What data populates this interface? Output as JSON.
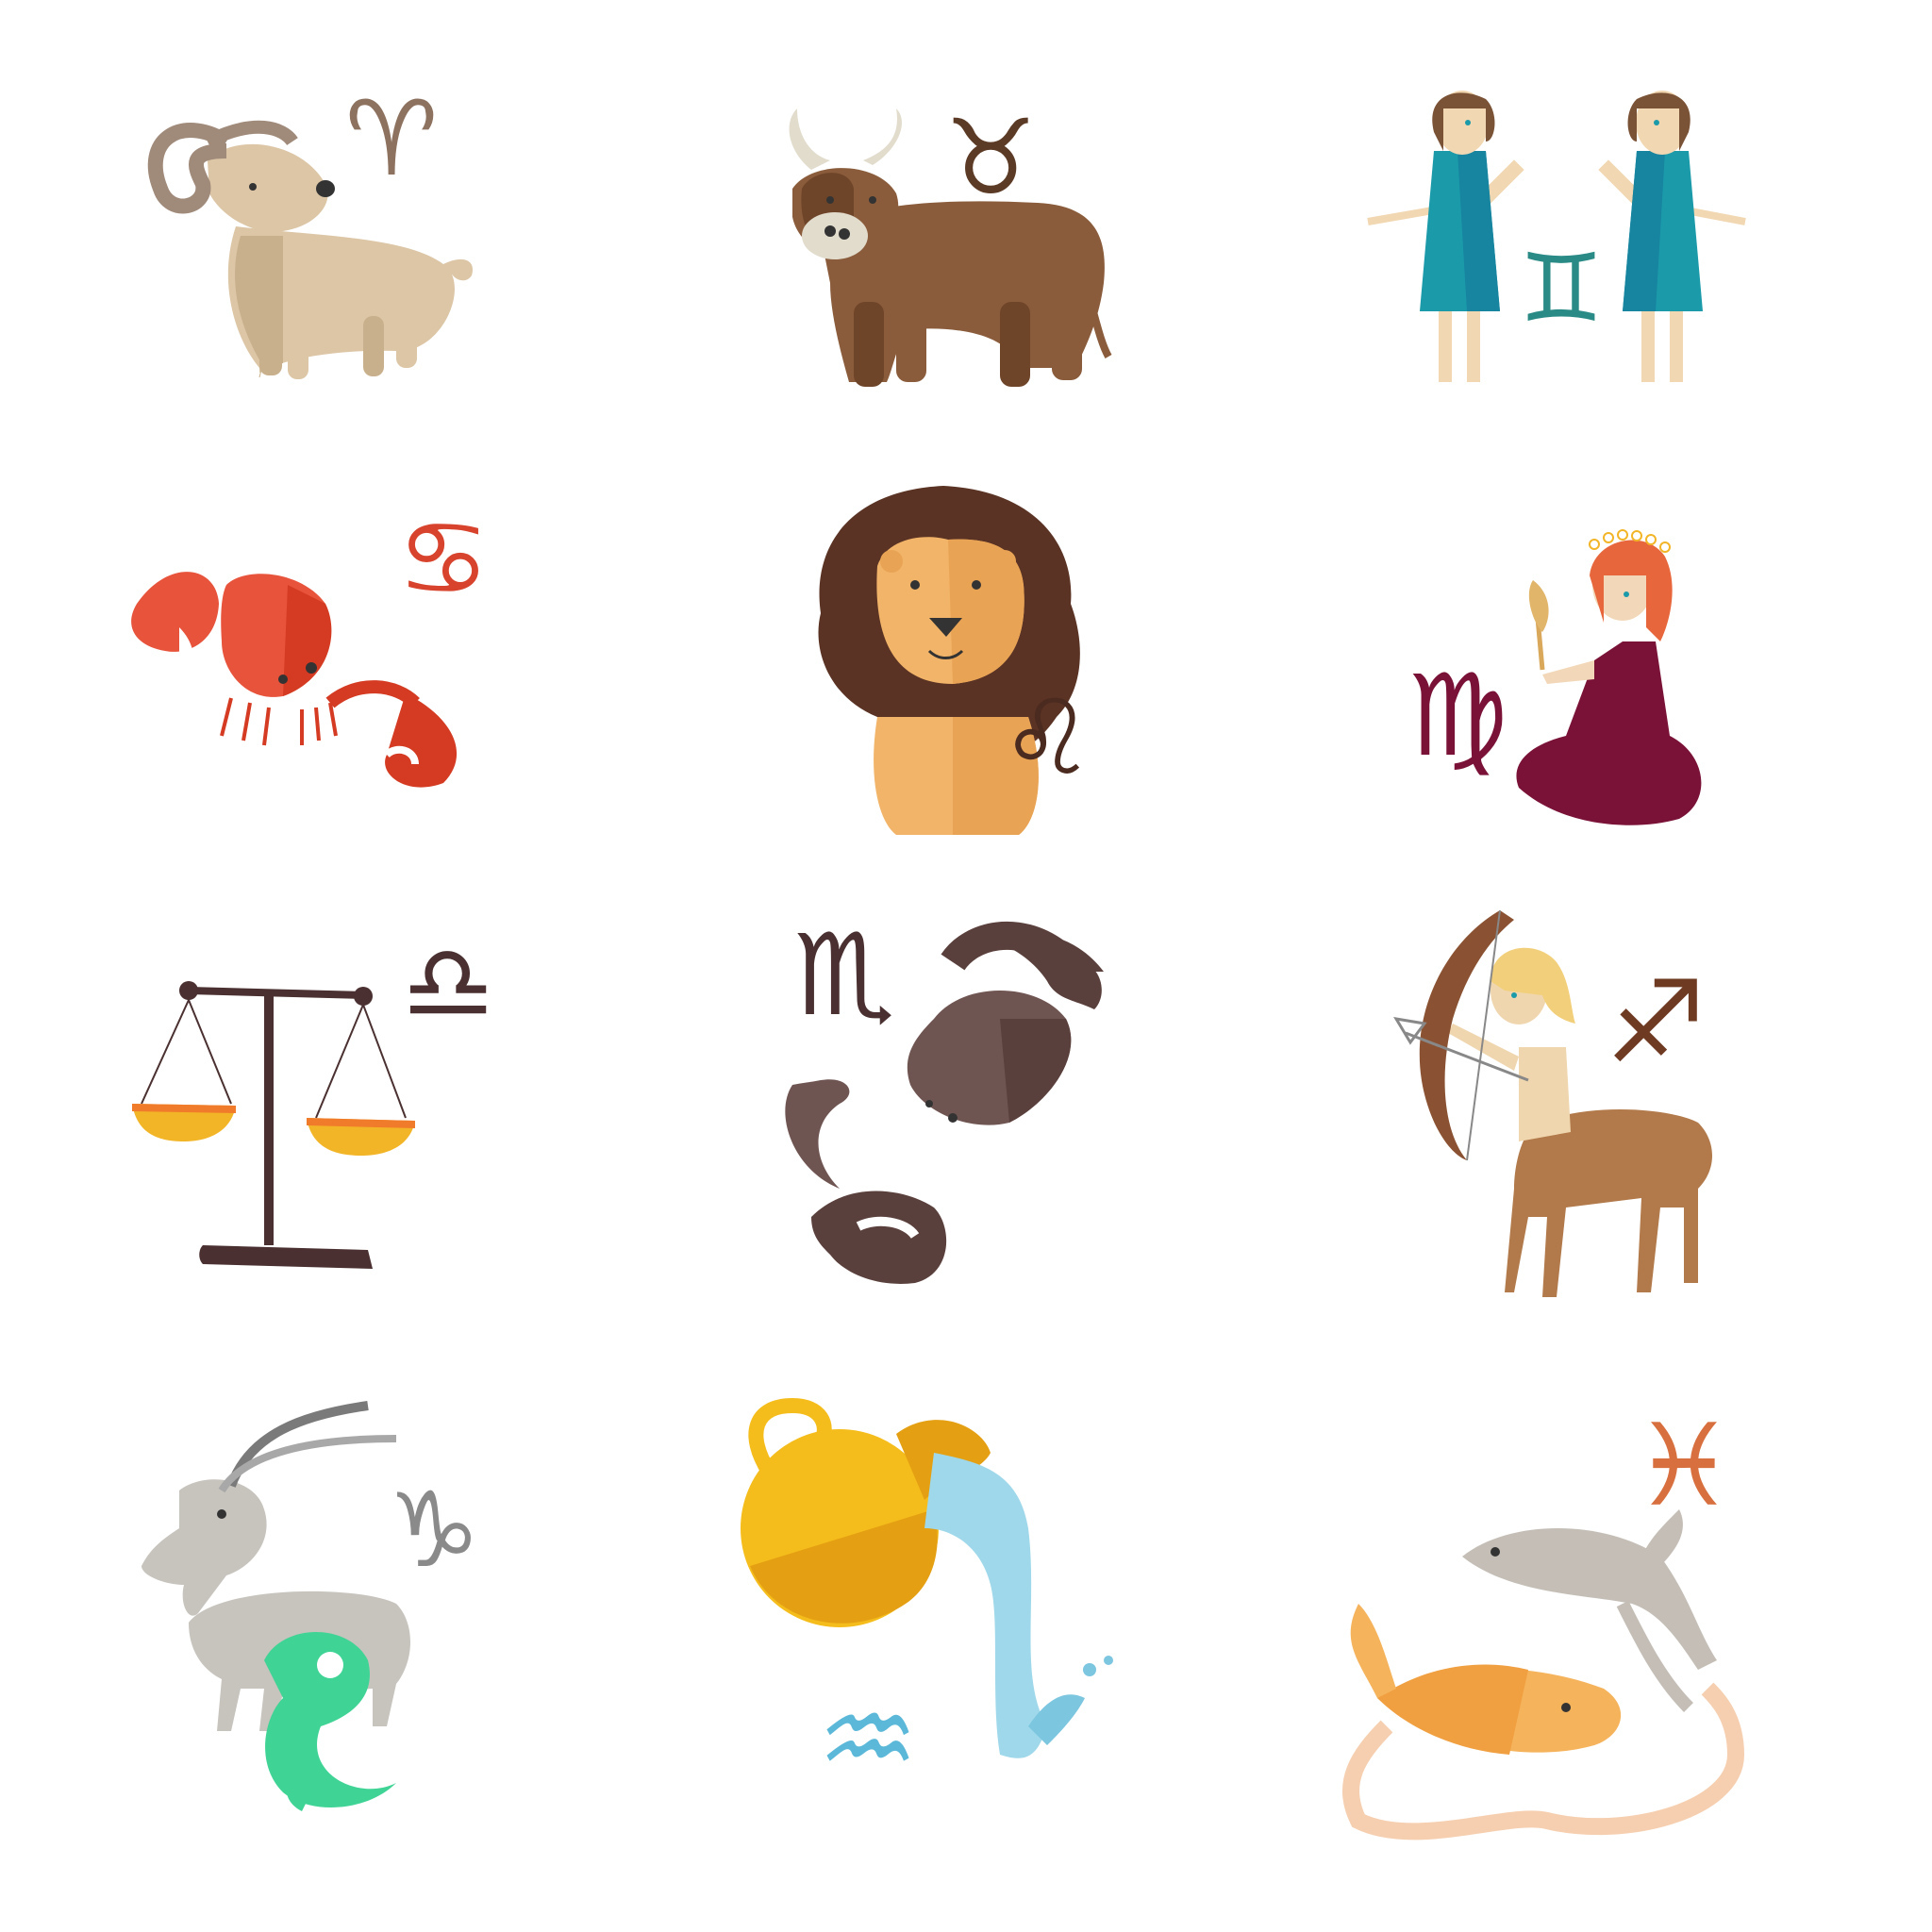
{
  "signs": [
    {
      "name": "aries",
      "glyph": "♈",
      "figure": "ram",
      "colors": {
        "body": "#dcc6a6",
        "shade": "#c9b08c",
        "horn": "#a08a7a",
        "glyph": "#8d725f"
      }
    },
    {
      "name": "taurus",
      "glyph": "♉",
      "figure": "bull",
      "colors": {
        "body": "#8a5c3b",
        "shade": "#6f4529",
        "horn": "#e2dccd",
        "glyph": "#5c3b26"
      }
    },
    {
      "name": "gemini",
      "glyph": "♊",
      "figure": "twins",
      "colors": {
        "body": "#1b9aaa",
        "skin": "#f1d7b2",
        "hair": "#7a5236",
        "glyph": "#2a8a86"
      }
    },
    {
      "name": "cancer",
      "glyph": "♋",
      "figure": "crab",
      "colors": {
        "body": "#e8533b",
        "shade": "#d43b22",
        "glyph": "#d8432d"
      }
    },
    {
      "name": "leo",
      "glyph": "♌",
      "figure": "lion",
      "colors": {
        "body": "#f2b468",
        "mane": "#5a3324",
        "glyph": "#4b2a1f"
      }
    },
    {
      "name": "virgo",
      "glyph": "♍",
      "figure": "maiden",
      "colors": {
        "body": "#7a1237",
        "skin": "#f2d8b8",
        "hair": "#e8663b",
        "glyph": "#7a1237"
      }
    },
    {
      "name": "libra",
      "glyph": "♎",
      "figure": "scales",
      "colors": {
        "body": "#4a3030",
        "pan": "#f3b528",
        "pan_top": "#f07b2a",
        "glyph": "#4a3030"
      }
    },
    {
      "name": "scorpio",
      "glyph": "♏",
      "figure": "scorpion",
      "colors": {
        "body": "#6f5552",
        "shade": "#5a403c",
        "glyph": "#4a3030"
      }
    },
    {
      "name": "sagittarius",
      "glyph": "♐",
      "figure": "centaur-archer",
      "colors": {
        "body": "#b27a4a",
        "skin": "#efd6ae",
        "hair": "#f2cf7a",
        "bow": "#8a5232",
        "glyph": "#6f3a22"
      }
    },
    {
      "name": "capricorn",
      "glyph": "♑",
      "figure": "sea-goat",
      "colors": {
        "body": "#c7c3bd",
        "tail": "#3fd495",
        "horn": "#7a7a7a",
        "glyph": "#8a8a8a"
      }
    },
    {
      "name": "aquarius",
      "glyph": "♒",
      "figure": "water-jar",
      "colors": {
        "body": "#f5bd1c",
        "shade": "#e4a012",
        "water": "#9fd8ea",
        "glyph": "#5bb8d8"
      }
    },
    {
      "name": "pisces",
      "glyph": "♓",
      "figure": "fish",
      "colors": {
        "body": "#c4beb6",
        "fish2": "#f5b35c",
        "cord": "#f6cfb0",
        "glyph": "#d86f3e"
      }
    }
  ]
}
